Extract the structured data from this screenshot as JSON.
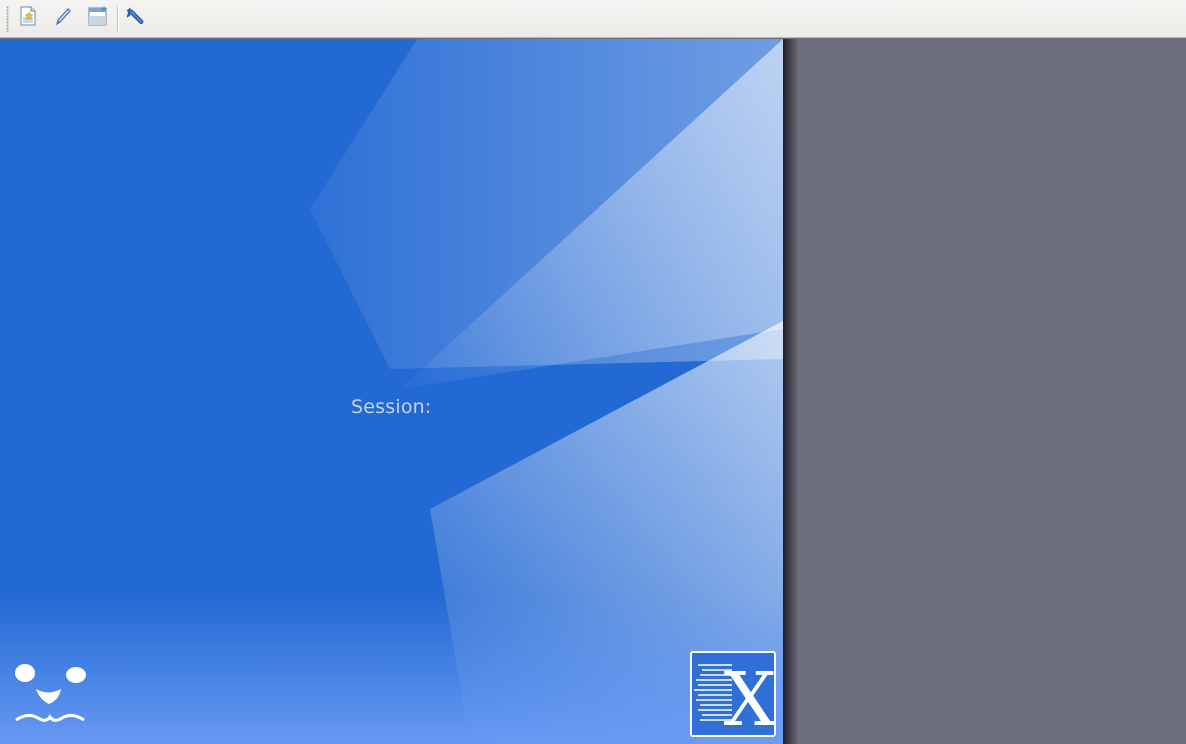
{
  "toolbar": {
    "buttons": [
      {
        "icon": "new-session-icon"
      },
      {
        "icon": "edit-pencil-icon"
      },
      {
        "icon": "window-settings-icon"
      },
      {
        "icon": "wrench-icon"
      }
    ]
  },
  "session": {
    "label": "Session:"
  },
  "colors": {
    "desktop_blue": "#236ed6",
    "right_pane": "#6e6f7e",
    "toolbar_bg": "#ecebe8"
  }
}
